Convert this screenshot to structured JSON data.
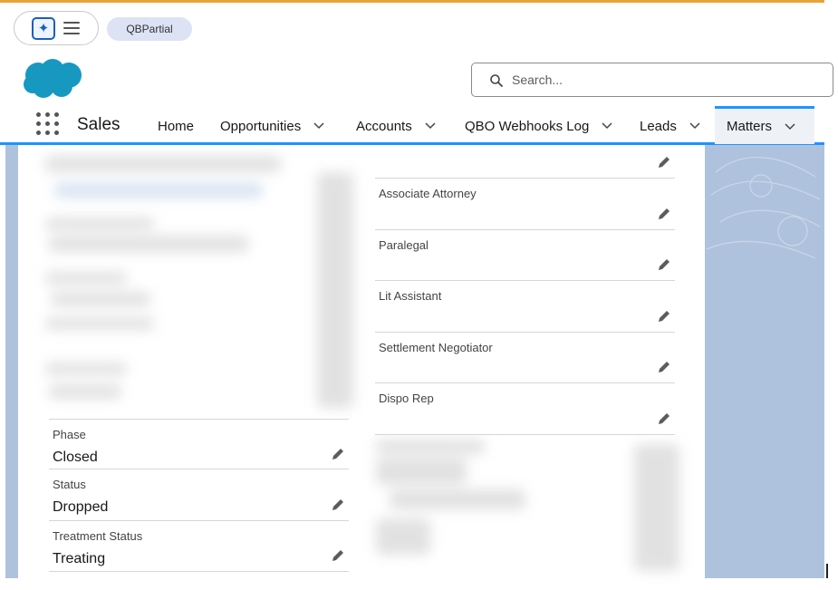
{
  "utility_bar": {
    "org_badge": "QBPartial"
  },
  "header": {
    "search": {
      "placeholder": "Search..."
    }
  },
  "nav": {
    "app_name": "Sales",
    "items": [
      {
        "label": "Home",
        "has_menu": false
      },
      {
        "label": "Opportunities",
        "has_menu": true
      },
      {
        "label": "Accounts",
        "has_menu": true
      },
      {
        "label": "QBO Webhooks Log",
        "has_menu": true
      },
      {
        "label": "Leads",
        "has_menu": true
      },
      {
        "label": "Matters",
        "has_menu": true,
        "active": true
      }
    ]
  },
  "record": {
    "right_fields": [
      {
        "label": ""
      },
      {
        "label": "Associate Attorney"
      },
      {
        "label": "Paralegal"
      },
      {
        "label": "Lit Assistant"
      },
      {
        "label": "Settlement Negotiator"
      },
      {
        "label": "Dispo Rep"
      }
    ],
    "left_fields": [
      {
        "label": "Phase",
        "value": "Closed"
      },
      {
        "label": "Status",
        "value": "Dropped"
      },
      {
        "label": "Treatment Status",
        "value": "Treating"
      }
    ]
  },
  "colors": {
    "brand_blue": "#1b96ff",
    "logo_blue": "#1798c1",
    "page_background": "#aec2dd",
    "top_accent": "#e8a33a"
  },
  "icons": {
    "agent": "agentforce-icon",
    "menu": "hamburger-menu-icon",
    "logo": "salesforce-cloud-logo",
    "search": "search-icon",
    "waffle": "app-launcher-icon",
    "chevron": "chevron-down-icon",
    "edit": "pencil-edit-icon"
  }
}
